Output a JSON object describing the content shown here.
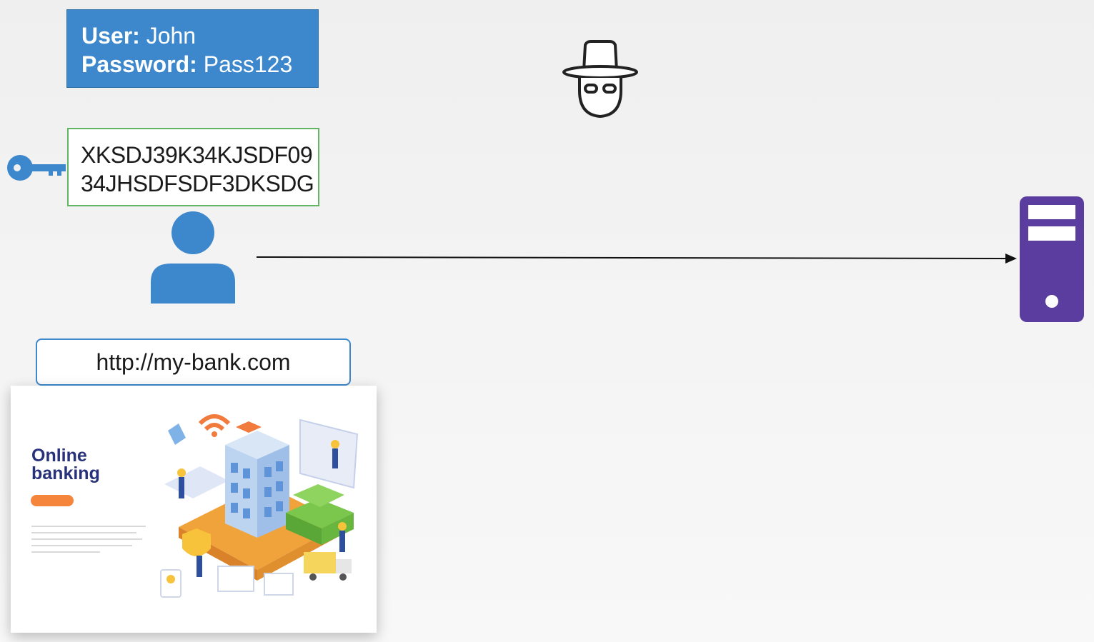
{
  "credentials": {
    "user_label": "User:",
    "user_value": "John",
    "password_label": "Password:",
    "password_value": "Pass123"
  },
  "token": {
    "line1": "XKSDJ39K34KJSDF09",
    "line2": "34JHSDFSDF3DKSDG"
  },
  "browser": {
    "url": "http://my-bank.com"
  },
  "website": {
    "heading_line1": "Online",
    "heading_line2": "banking"
  },
  "icons": {
    "key": "key-icon",
    "user": "user-icon",
    "hacker": "hacker-icon",
    "server": "server-icon",
    "arrow": "arrow-icon"
  },
  "colors": {
    "credentials_bg": "#3d88cc",
    "token_border": "#62b562",
    "user_blue": "#3d88cc",
    "server_purple": "#5a3d9e",
    "site_heading": "#28327a",
    "site_cta": "#f5853a"
  }
}
